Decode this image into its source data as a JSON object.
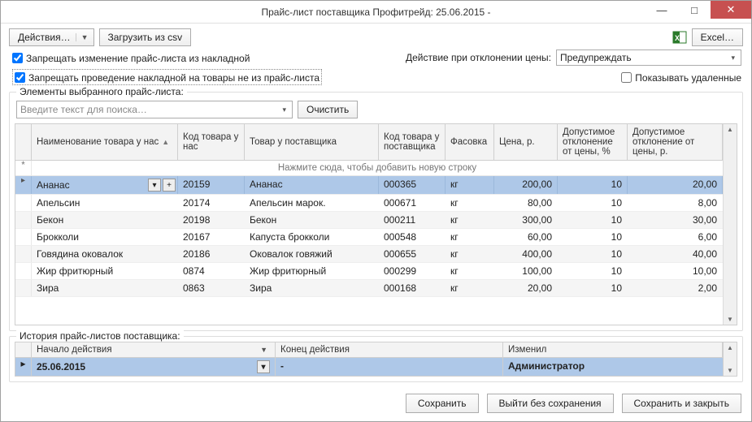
{
  "title": "Прайс-лист поставщика Профитрейд: 25.06.2015 -",
  "toolbar": {
    "actions": "Действия…",
    "load_csv": "Загрузить из csv",
    "excel": "Excel…"
  },
  "opts": {
    "forbid_change": "Запрещать изменение прайс-листа из накладной",
    "action_on_deviation_label": "Действие при отклонении цены:",
    "action_on_deviation_value": "Предупреждать",
    "forbid_accept": "Запрещать проведение накладной на товары не из прайс-листа",
    "show_deleted": "Показывать удаленные"
  },
  "elements_legend": "Элементы выбранного прайс-листа:",
  "search": {
    "placeholder": "Введите текст для поиска…",
    "clear": "Очистить"
  },
  "cols": {
    "name": "Наименование товара у нас",
    "our_code": "Код товара у нас",
    "supplier_name": "Товар у поставщика",
    "supplier_code": "Код товара у поставщика",
    "pack": "Фасовка",
    "price": "Цена, р.",
    "dev_pct": "Допустимое отклонение от цены, %",
    "dev_rub": "Допустимое отклонение от цены, р."
  },
  "new_row_hint": "Нажмите сюда, чтобы добавить новую строку",
  "rows": [
    {
      "name": "Ананас",
      "our_code": "20159",
      "supplier_name": "Ананас",
      "supplier_code": "000365",
      "pack": "кг",
      "price": "200,00",
      "dev_pct": "10",
      "dev_rub": "20,00"
    },
    {
      "name": "Апельсин",
      "our_code": "20174",
      "supplier_name": "Апельсин марок.",
      "supplier_code": "000671",
      "pack": "кг",
      "price": "80,00",
      "dev_pct": "10",
      "dev_rub": "8,00"
    },
    {
      "name": "Бекон",
      "our_code": "20198",
      "supplier_name": "Бекон",
      "supplier_code": "000211",
      "pack": "кг",
      "price": "300,00",
      "dev_pct": "10",
      "dev_rub": "30,00"
    },
    {
      "name": "Брокколи",
      "our_code": "20167",
      "supplier_name": "Капуста брокколи",
      "supplier_code": "000548",
      "pack": "кг",
      "price": "60,00",
      "dev_pct": "10",
      "dev_rub": "6,00"
    },
    {
      "name": "Говядина оковалок",
      "our_code": "20186",
      "supplier_name": "Оковалок говяжий",
      "supplier_code": "000655",
      "pack": "кг",
      "price": "400,00",
      "dev_pct": "10",
      "dev_rub": "40,00"
    },
    {
      "name": "Жир фритюрный",
      "our_code": "0874",
      "supplier_name": "Жир фритюрный",
      "supplier_code": "000299",
      "pack": "кг",
      "price": "100,00",
      "dev_pct": "10",
      "dev_rub": "10,00"
    },
    {
      "name": "Зира",
      "our_code": "0863",
      "supplier_name": "Зира",
      "supplier_code": "000168",
      "pack": "кг",
      "price": "20,00",
      "dev_pct": "10",
      "dev_rub": "2,00"
    }
  ],
  "history": {
    "legend": "История прайс-листов поставщика:",
    "cols": {
      "start": "Начало действия",
      "end": "Конец действия",
      "changed": "Изменил"
    },
    "row": {
      "start": "25.06.2015",
      "end": "-",
      "changed": "Администратор"
    }
  },
  "footer": {
    "save": "Сохранить",
    "exit": "Выйти без сохранения",
    "save_close": "Сохранить и закрыть"
  }
}
